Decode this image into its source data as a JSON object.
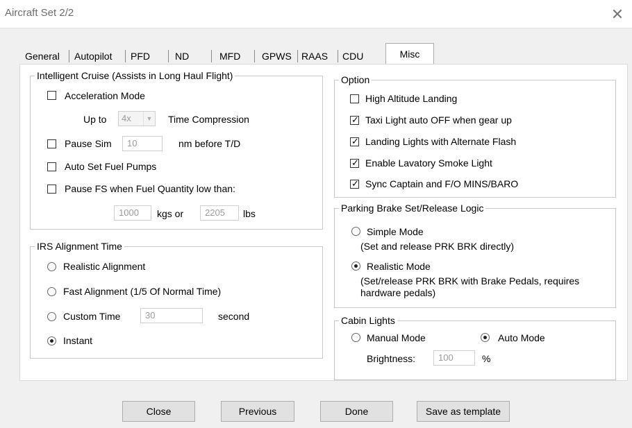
{
  "window": {
    "title": "Aircraft Set 2/2",
    "close_glyph": "✕"
  },
  "tabs": [
    {
      "label": "General"
    },
    {
      "label": "Autopilot"
    },
    {
      "label": "PFD"
    },
    {
      "label": "ND"
    },
    {
      "label": "MFD"
    },
    {
      "label": "GPWS"
    },
    {
      "label": "RAAS"
    },
    {
      "label": "CDU"
    },
    {
      "label": "Misc",
      "active": true
    }
  ],
  "cruise": {
    "legend": "Intelligent Cruise (Assists in Long Haul Flight)",
    "accel_label": "Acceleration Mode",
    "accel_checked": false,
    "upto_label": "Up to",
    "compression_value": "4x",
    "compression_label": "Time Compression",
    "pause_sim_label": "Pause Sim",
    "pause_sim_checked": false,
    "pause_sim_value": "10",
    "pause_sim_suffix": "nm before T/D",
    "fuel_pumps_label": "Auto Set Fuel Pumps",
    "fuel_pumps_checked": false,
    "pause_fuel_label": "Pause FS when Fuel Quantity low than:",
    "pause_fuel_checked": false,
    "kgs_value": "1000",
    "kgs_label": "kgs or",
    "lbs_value": "2205",
    "lbs_label": "lbs"
  },
  "irs": {
    "legend": "IRS Alignment Time",
    "realistic_label": "Realistic Alignment",
    "fast_label": "Fast Alignment (1/5 Of Normal Time)",
    "custom_label": "Custom Time",
    "custom_value": "30",
    "custom_suffix": "second",
    "instant_label": "Instant",
    "selected": "instant"
  },
  "option": {
    "legend": "Option",
    "items": [
      {
        "label": "High Altitude Landing",
        "checked": false
      },
      {
        "label": "Taxi Light auto OFF when gear up",
        "checked": true
      },
      {
        "label": "Landing Lights with Alternate Flash",
        "checked": true
      },
      {
        "label": "Enable Lavatory Smoke Light",
        "checked": true
      },
      {
        "label": "Sync Captain and F/O MINS/BARO",
        "checked": true
      }
    ]
  },
  "parking": {
    "legend": "Parking Brake Set/Release Logic",
    "simple_label": "Simple Mode",
    "simple_desc": "(Set and release PRK BRK directly)",
    "realistic_label": "Realistic Mode",
    "realistic_desc_1": "(Set/release PRK BRK with Brake Pedals, requires",
    "realistic_desc_2": "hardware pedals)",
    "selected": "realistic"
  },
  "cabin": {
    "legend": "Cabin Lights",
    "manual_label": "Manual Mode",
    "auto_label": "Auto Mode",
    "selected": "auto",
    "brightness_label": "Brightness:",
    "brightness_value": "100",
    "brightness_unit": "%"
  },
  "buttons": {
    "close": "Close",
    "previous": "Previous",
    "done": "Done",
    "save_template": "Save as template"
  },
  "check_glyph": "✓"
}
